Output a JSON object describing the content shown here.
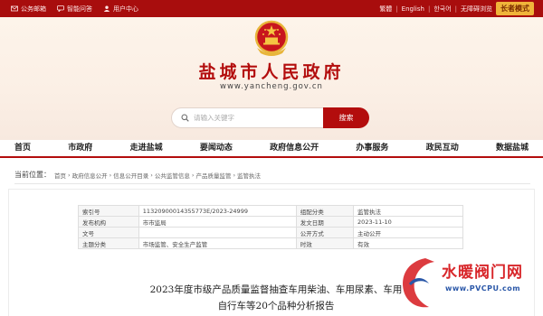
{
  "topbar": {
    "links": [
      {
        "label": "公务邮箱",
        "icon": "mail-icon"
      },
      {
        "label": "智能问答",
        "icon": "chat-icon"
      },
      {
        "label": "用户中心",
        "icon": "user-icon"
      }
    ],
    "right": {
      "traditional": "繁體",
      "english": "English",
      "korean": "한국어",
      "accessible": "无障碍浏览",
      "elder_mode": "长者模式"
    }
  },
  "header": {
    "title": "盐城市人民政府",
    "domain": "www.yancheng.gov.cn"
  },
  "search": {
    "placeholder": "请输入关键字",
    "button": "搜索"
  },
  "nav": {
    "items": [
      "首页",
      "市政府",
      "走进盐城",
      "要闻动态",
      "政府信息公开",
      "办事服务",
      "政民互动",
      "数据盐城"
    ]
  },
  "breadcrumb": {
    "lead": "当前位置：",
    "items": [
      "首页",
      "政府信息公开",
      "信息公开目录",
      "公共监管信息",
      "产品质量监管",
      "监管执法"
    ],
    "separator": "›"
  },
  "meta": {
    "rows": [
      {
        "k1": "索引号",
        "v1": "11320900014355773E/2023-24999",
        "k2": "组配分类",
        "v2": "监管执法"
      },
      {
        "k1": "发布机构",
        "v1": "市市监局",
        "k2": "发文日期",
        "v2": "2023-11-10"
      },
      {
        "k1": "文号",
        "v1": "",
        "k2": "公开方式",
        "v2": "主动公开"
      },
      {
        "k1": "主题分类",
        "v1": "市场监管、安全生产监管",
        "k2": "时效",
        "v2": "有效"
      }
    ]
  },
  "article": {
    "title_line1": "2023年度市级产品质量监督抽查车用柴油、车用尿素、车用",
    "title_line2": "自行车等20个品种分析报告"
  },
  "watermark": {
    "name": "水暖阀门网",
    "url": "www.PVCPU.com"
  },
  "colors": {
    "brand_red": "#b30d0d",
    "topbar_red": "#a80d0d",
    "elder_gold": "#f0b43a",
    "watermark_red": "#d8262a",
    "watermark_blue": "#2a57a8"
  }
}
